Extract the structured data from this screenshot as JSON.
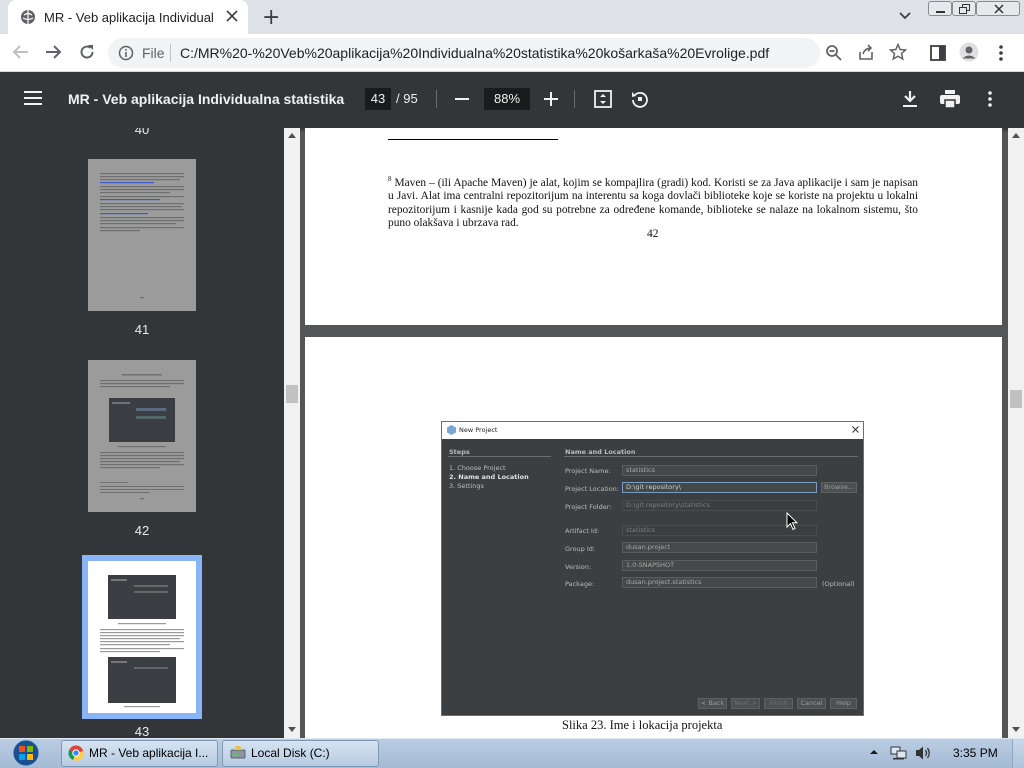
{
  "browser": {
    "tab_title": "MR - Veb aplikacija Individualna",
    "new_tab": "+",
    "omnibox_scheme": "File",
    "url": "C:/MR%20-%20Veb%20aplikacija%20Individualna%20statistika%20košarkaša%20Evrolige.pdf"
  },
  "pdf_toolbar": {
    "title": "MR - Veb aplikacija Individualna statistika ...",
    "current_page": "43",
    "page_total": "/ 95",
    "zoom": "88%"
  },
  "sidebar": {
    "thumbnails": [
      {
        "label": "40"
      },
      {
        "label": "41"
      },
      {
        "label": "42"
      },
      {
        "label": "43",
        "selected": true
      }
    ]
  },
  "page42": {
    "footnote_mark": "8",
    "footnote": "Maven – (ili Apache  Maven) je alat, kojim se kompajlira (gradi) kod. Koristi se za Java aplikacije i sam je napisan u Javi. Alat ima centralni repozitorijum na interentu sa koga dovlači biblioteke koje se koriste na projektu u lokalni repozitorijum i kasnije kada god su potrebne za određene komande, biblioteke se nalaze na lokalnom sistemu, što puno olakšava i ubrzava rad.",
    "page_number": "42"
  },
  "page43": {
    "caption": "Slika 23. Ime i lokacija  projekta",
    "dialog": {
      "title": "New Project",
      "steps_header": "Steps",
      "steps": [
        "1.   Choose Project",
        "2.   Name and Location",
        "3.   Settings"
      ],
      "section_header": "Name and Location",
      "fields": {
        "project_name_label": "Project Name:",
        "project_name": "statistics",
        "project_location_label": "Project Location:",
        "project_location": "D:\\git repository\\",
        "browse": "Browse...",
        "project_folder_label": "Project Folder:",
        "project_folder": "D:\\git repository\\statistics",
        "artifact_id_label": "Artifact Id:",
        "artifact_id": "statistics",
        "group_id_label": "Group Id:",
        "group_id": "dusan.project",
        "version_label": "Version:",
        "version": "1.0-SNAPSHOT",
        "package_label": "Package:",
        "package": "dusan.project.statistics",
        "optional": "(Optional)"
      },
      "buttons": {
        "back": "< Back",
        "next": "Next >",
        "finish": "Finish",
        "cancel": "Cancel",
        "help": "Help"
      }
    }
  },
  "taskbar": {
    "tasks": [
      "MR - Veb aplikacija I...",
      "Local Disk (C:)"
    ],
    "clock": "3:35 PM"
  },
  "colors": {
    "pdf_toolbar": "#323639",
    "viewer_bg": "#525659",
    "thumb_selected": "#8ab4f8"
  }
}
